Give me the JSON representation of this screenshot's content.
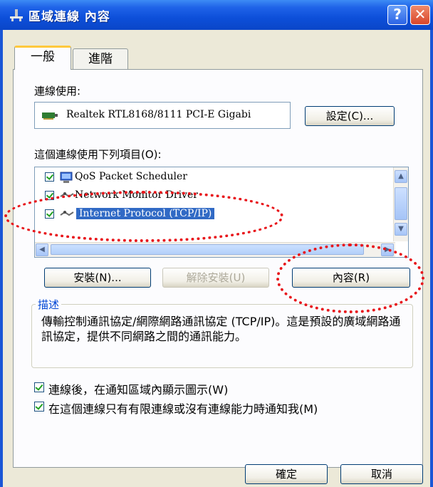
{
  "window": {
    "title": "區域連線 內容",
    "help_glyph": "?",
    "close_glyph": "✕"
  },
  "tabs": [
    {
      "label": "一般",
      "active": true
    },
    {
      "label": "進階",
      "active": false
    }
  ],
  "connect_using": {
    "label": "連線使用:",
    "adapter": "Realtek RTL8168/8111 PCI-E Gigabi",
    "configure_button": "設定(C)..."
  },
  "components": {
    "label": "這個連線使用下列項目(O):",
    "items": [
      {
        "label": "QoS Packet Scheduler",
        "checked": true,
        "icon": "qos-scheduler-icon"
      },
      {
        "label": "Network Monitor Driver",
        "checked": true,
        "icon": "network-protocol-icon"
      },
      {
        "label": "Internet Protocol (TCP/IP)",
        "checked": true,
        "selected": true,
        "icon": "network-protocol-icon"
      }
    ],
    "scroll_up": "▲",
    "scroll_down": "▼",
    "scroll_left": "◀",
    "scroll_right": "▶"
  },
  "buttons": {
    "install": "安裝(N)...",
    "uninstall": "解除安裝(U)",
    "properties": "內容(R)"
  },
  "description": {
    "title": "描述",
    "text": "傳輸控制通訊協定/網際網路通訊協定 (TCP/IP)。這是預設的廣域網路通訊協定，提供不同網路之間的通訊能力。"
  },
  "options": {
    "show_icon": "連線後，在通知區域內顯示圖示(W)",
    "notify_limited": "在這個連線只有有限連線或沒有連線能力時通知我(M)"
  },
  "footer": {
    "ok": "確定",
    "cancel": "取消"
  },
  "colors": {
    "title_bar": "#0a46c8",
    "selection": "#316ac5",
    "callout": "#e8161b",
    "description_title": "#0046d5"
  }
}
